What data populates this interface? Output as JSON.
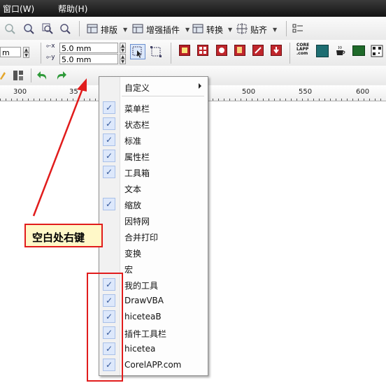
{
  "menubar": {
    "items": [
      "窗口(W)",
      "帮助(H)"
    ]
  },
  "toolbar_main": {
    "layout_label": "排版",
    "plugins_label": "增强插件",
    "convert_label": "转换",
    "align_label": "贴齐"
  },
  "property_bar": {
    "left_unit": "m",
    "offset_x": "5.0 mm",
    "offset_y": "5.0 mm",
    "corel_app_label": "CORE LAPP .com"
  },
  "ruler": {
    "labels": [
      "300",
      "35",
      "500",
      "550",
      "600"
    ]
  },
  "context_menu": {
    "items": [
      {
        "label": "自定义",
        "checked": false,
        "submenu": true
      },
      {
        "label": "菜单栏",
        "checked": true
      },
      {
        "label": "状态栏",
        "checked": true
      },
      {
        "label": "标准",
        "checked": true
      },
      {
        "label": "属性栏",
        "checked": true
      },
      {
        "label": "工具箱",
        "checked": true
      },
      {
        "label": "文本",
        "checked": false
      },
      {
        "label": "缩放",
        "checked": true
      },
      {
        "label": "因特网",
        "checked": false
      },
      {
        "label": "合并打印",
        "checked": false
      },
      {
        "label": "变换",
        "checked": false
      },
      {
        "label": "宏",
        "checked": false
      },
      {
        "label": "我的工具",
        "checked": true
      },
      {
        "label": "DrawVBA",
        "checked": true
      },
      {
        "label": "hiceteaB",
        "checked": true
      },
      {
        "label": "插件工具栏",
        "checked": true
      },
      {
        "label": "hicetea",
        "checked": true
      },
      {
        "label": "CorelAPP.com",
        "checked": true
      }
    ]
  },
  "annotation": {
    "text": "空白处右键",
    "color": "#e11c1c"
  },
  "icons": [
    "zoom-icon",
    "layout-icon",
    "plugin-icon",
    "convert-icon",
    "align-icon",
    "undo-icon",
    "redo-icon"
  ]
}
